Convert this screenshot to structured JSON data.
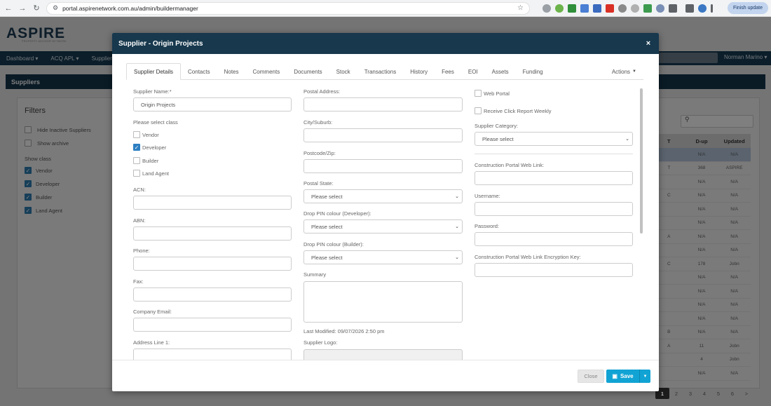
{
  "browser": {
    "url": "portal.aspirenetwork.com.au/admin/buildermanager",
    "finish_update": "Finish update"
  },
  "page": {
    "logo": "ASPIRE",
    "logo_sub": "PROPERTY ADVISOR NETWORK",
    "nav": [
      "Dashboard ▾",
      "ACQ APL ▾",
      "Supplier ▾"
    ],
    "nav_user": "Norman Marino ▾",
    "section_title": "Suppliers",
    "filters_title": "Filters",
    "filters": [
      {
        "label": "Hide Inactive Suppliers",
        "checked": false
      },
      {
        "label": "Show archive",
        "checked": false
      }
    ],
    "show_class_label": "Show class",
    "show_class": [
      {
        "label": "Vendor",
        "checked": true
      },
      {
        "label": "Developer",
        "checked": true
      },
      {
        "label": "Builder",
        "checked": true
      },
      {
        "label": "Land Agent",
        "checked": true
      }
    ],
    "table_headers": [
      "T",
      "D-up",
      "Updated"
    ],
    "table_rows": [
      [
        "",
        "N/A",
        "N/A"
      ],
      [
        "T",
        "368",
        "ASPIRE"
      ],
      [
        "",
        "N/A",
        "N/A"
      ],
      [
        "C",
        "N/A",
        "N/A"
      ],
      [
        "",
        "N/A",
        "N/A"
      ],
      [
        "",
        "N/A",
        "N/A"
      ],
      [
        "A",
        "N/A",
        "N/A"
      ],
      [
        "",
        "N/A",
        "N/A"
      ],
      [
        "C",
        "178",
        "Jobn"
      ],
      [
        "",
        "N/A",
        "N/A"
      ],
      [
        "",
        "N/A",
        "N/A"
      ],
      [
        "",
        "N/A",
        "N/A"
      ],
      [
        "",
        "N/A",
        "N/A"
      ],
      [
        "B",
        "N/A",
        "N/A"
      ],
      [
        "A",
        "11",
        "Jobn"
      ],
      [
        "",
        "4",
        "Jobn"
      ],
      [
        "",
        "N/A",
        "N/A"
      ]
    ],
    "pages": [
      "1",
      "2",
      "3",
      "4",
      "5",
      "6",
      ">"
    ]
  },
  "modal": {
    "title": "Supplier - Origin Projects",
    "close_symbol": "×",
    "tabs": [
      "Supplier Details",
      "Contacts",
      "Notes",
      "Comments",
      "Documents",
      "Stock",
      "Transactions",
      "History",
      "Fees",
      "EOI",
      "Assets",
      "Funding"
    ],
    "actions_label": "Actions",
    "col1": {
      "supplier_name_label": "Supplier Name:*",
      "supplier_name_value": "Origin Projects",
      "class_label": "Please select class",
      "classes": [
        {
          "label": "Vendor",
          "checked": false
        },
        {
          "label": "Developer",
          "checked": true
        },
        {
          "label": "Builder",
          "checked": false
        },
        {
          "label": "Land Agent",
          "checked": false
        }
      ],
      "acn_label": "ACN:",
      "abn_label": "ABN:",
      "phone_label": "Phone:",
      "fax_label": "Fax:",
      "email_label": "Company Email:",
      "address1_label": "Address Line 1:"
    },
    "col2": {
      "postal_address_label": "Postal Address:",
      "city_label": "City/Suburb:",
      "postcode_label": "Postcode/Zip:",
      "postal_state_label": "Postal State:",
      "postal_state_value": "Please select",
      "pin_dev_label": "Drop PIN colour (Developer):",
      "pin_dev_value": "Please select",
      "pin_builder_label": "Drop PIN colour (Builder):",
      "pin_builder_value": "Please select",
      "summary_label": "Summary",
      "last_modified": "Last Modified: 09/07/2026 2:50 pm",
      "logo_label": "Supplier Logo:"
    },
    "col3": {
      "web_portal_label": "Web Portal",
      "web_portal_checked": false,
      "click_report_label": "Receive Click Report Weekly",
      "click_report_checked": false,
      "category_label": "Supplier Category:",
      "category_value": "Please select",
      "portal_link_label": "Construction Portal Web Link:",
      "username_label": "Username:",
      "password_label": "Password:",
      "encryption_label": "Construction Portal Web Link Encryption Key:"
    },
    "footer": {
      "close_label": "Close",
      "save_label": "Save"
    }
  }
}
